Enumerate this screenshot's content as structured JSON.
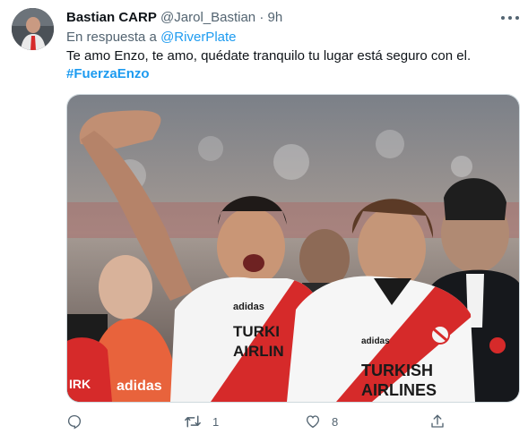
{
  "tweet": {
    "display_name": "Bastian CARP",
    "handle": "@Jarol_Bastian",
    "separator": "·",
    "time": "9h",
    "reply_prefix": "En respuesta a",
    "reply_to": "@RiverPlate",
    "text": "Te amo Enzo, te amo, quédate tranquilo tu lugar está seguro con el.",
    "hashtag": "#FuerzaEnzo",
    "photo": {
      "sponsor_text": "TURKISH AIRLINES",
      "sponsor_text_short": "TURKI AIRLIN",
      "brand": "adidas"
    },
    "actions": {
      "reply_icon": "reply-icon",
      "retweet_icon": "retweet-icon",
      "retweet_count": "1",
      "like_icon": "heart-icon",
      "like_count": "8",
      "share_icon": "share-icon"
    }
  },
  "colors": {
    "accent": "#1d9bf0",
    "secondary_text": "#536471",
    "primary_text": "#0f1419",
    "river_red": "#d62a2a"
  }
}
